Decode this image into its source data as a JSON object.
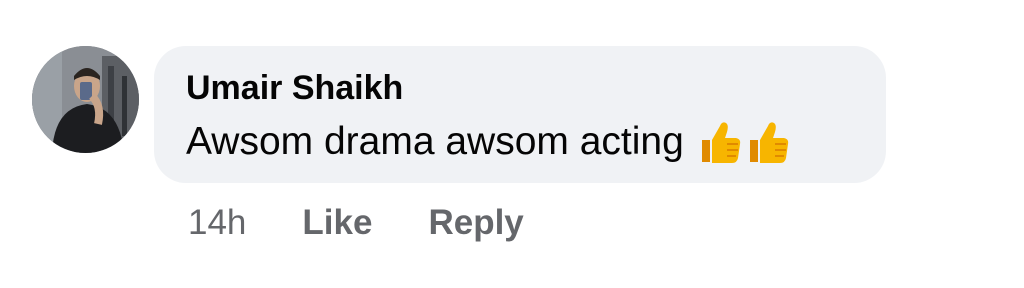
{
  "comment": {
    "author": "Umair Shaikh",
    "text": "Awsom drama awsom acting",
    "emojis": [
      "thumbs-up-icon",
      "thumbs-up-icon"
    ],
    "timestamp": "14h",
    "like_label": "Like",
    "reply_label": "Reply"
  },
  "colors": {
    "bubble": "#f0f2f5",
    "text": "#050505",
    "secondary": "#65676b",
    "emoji": "#f7b500"
  }
}
